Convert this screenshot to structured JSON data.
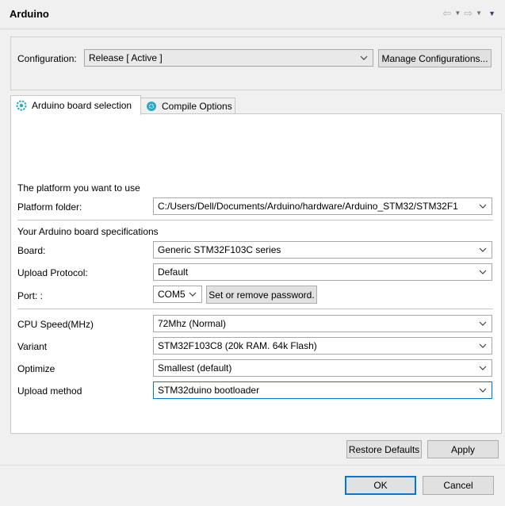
{
  "header": {
    "title": "Arduino"
  },
  "configuration": {
    "label": "Configuration:",
    "value": "Release  [ Active ]",
    "manage_button": "Manage Configurations..."
  },
  "tabs": [
    {
      "label": "Arduino board selection",
      "active": true
    },
    {
      "label": "Compile Options",
      "active": false
    }
  ],
  "platform": {
    "section_title": "The platform you want to use",
    "folder_label": "Platform folder:",
    "folder_value": "C:/Users/Dell/Documents/Arduino/hardware/Arduino_STM32/STM32F1"
  },
  "board_specs": {
    "section_title": "Your Arduino board specifications",
    "board_label": "Board:",
    "board_value": "Generic STM32F103C series",
    "upload_protocol_label": "Upload Protocol:",
    "upload_protocol_value": "Default",
    "port_label": "Port: :",
    "port_value": "COM5",
    "password_button": "Set or remove password."
  },
  "options": {
    "cpu_speed_label": "CPU Speed(MHz)",
    "cpu_speed_value": "72Mhz (Normal)",
    "variant_label": "Variant",
    "variant_value": "STM32F103C8 (20k RAM. 64k Flash)",
    "optimize_label": "Optimize",
    "optimize_value": "Smallest (default)",
    "upload_method_label": "Upload method",
    "upload_method_value": "STM32duino bootloader"
  },
  "actions": {
    "restore_defaults": "Restore Defaults",
    "apply": "Apply",
    "ok": "OK",
    "cancel": "Cancel"
  },
  "colors": {
    "accent": "#0078d7",
    "tab_icon": "#2aa8c4"
  }
}
